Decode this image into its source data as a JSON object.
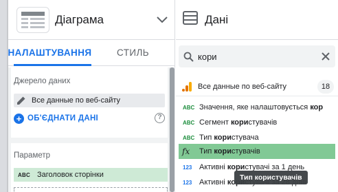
{
  "left_panel": {
    "header": {
      "title": "Діаграма",
      "chart_icon": "table-chart-icon",
      "dropdown_icon": "chevron-down-icon"
    },
    "tabs": [
      {
        "label": "НАЛАШТУВАННЯ",
        "active": true
      },
      {
        "label": "СТИЛЬ",
        "active": false
      }
    ],
    "data_source": {
      "section_label": "Джерело даних",
      "source_name": "Все данные по веб-сайту",
      "blend_label": "ОБ'ЄДНАТИ ДАНІ"
    },
    "parameter": {
      "section_label": "Параметр",
      "field_type": "ABC",
      "field_name": "Заголовок сторінки"
    }
  },
  "right_panel": {
    "header": {
      "title": "Дані",
      "icon": "data-table-icon"
    },
    "search": {
      "value": "кори",
      "placeholder": ""
    },
    "source": {
      "name": "Все данные по веб-сайту",
      "count": "18"
    },
    "fields": [
      {
        "type": "ABC",
        "pre": "Значення, яке налаштовується ",
        "match": "кор",
        "post": "",
        "selected": false
      },
      {
        "type": "ABC",
        "pre": "Сегмент ",
        "match": "кори",
        "post": "стувачів",
        "selected": false
      },
      {
        "type": "ABC",
        "pre": "Тип ",
        "match": "кори",
        "post": "стувача",
        "selected": false
      },
      {
        "type": "fx",
        "pre": "Тип ",
        "match": "кори",
        "post": "стувачів",
        "selected": true
      },
      {
        "type": "123",
        "pre": "Активні ",
        "match": "кори",
        "post": "стувачі за 1 день",
        "selected": false
      },
      {
        "type": "123",
        "pre": "Активні ",
        "match": "кори",
        "post": "стувачі за 28 днів",
        "selected": false
      }
    ],
    "tooltip": "Тип користувачів"
  },
  "colors": {
    "accent": "#1a73e8",
    "dimension_green": "#1e8e3e",
    "selected_field": "#81c995",
    "parameter_bg": "#ceead6",
    "source_icon_orange": "#f9ab00"
  }
}
